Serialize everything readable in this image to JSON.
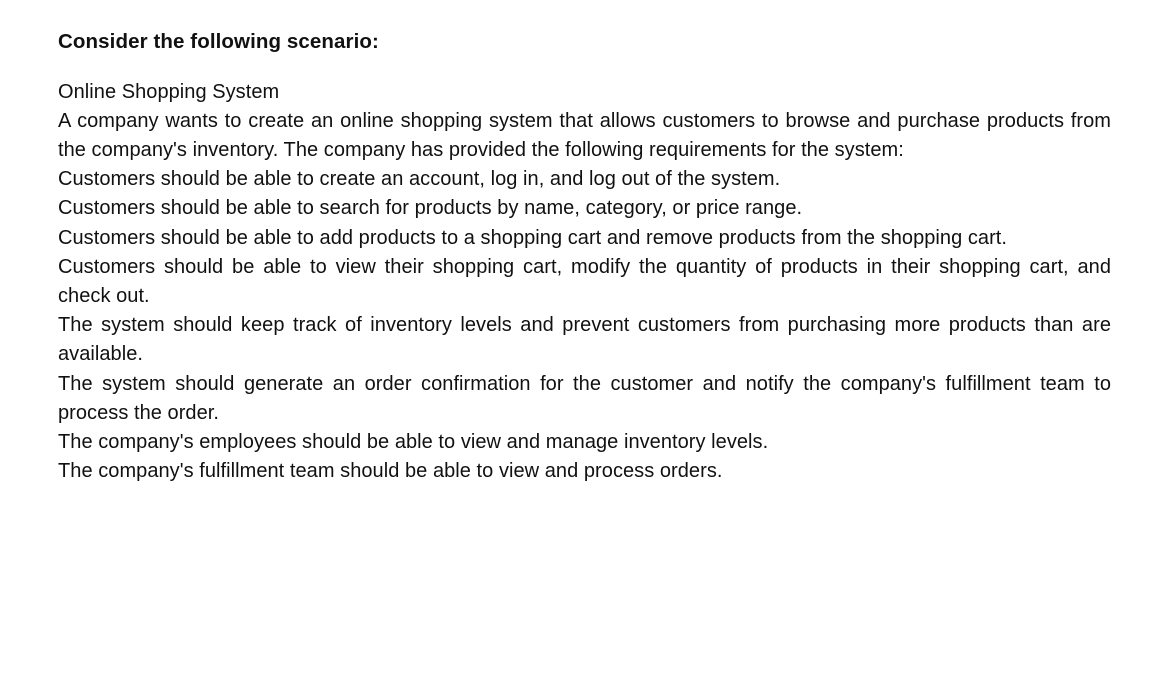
{
  "heading": "Consider the following scenario:",
  "paragraphs": [
    {
      "text": "Online Shopping System",
      "justify": false
    },
    {
      "text": "A company wants to create an online shopping system that allows customers to browse and purchase products from the company's inventory. The company has provided the following requirements for the system:",
      "justify": true
    },
    {
      "text": "Customers should be able to create an account, log in, and log out of the system.",
      "justify": false
    },
    {
      "text": "Customers should be able to search for products by name, category, or price range.",
      "justify": false
    },
    {
      "text": "Customers should be able to add products to a shopping cart and remove products from the shopping cart.",
      "justify": true
    },
    {
      "text": "Customers should be able to view their shopping cart, modify the quantity of products in their shopping cart, and check out.",
      "justify": true
    },
    {
      "text": "The system should keep track of inventory levels and prevent customers from purchasing more products than are available.",
      "justify": true
    },
    {
      "text": "The system should generate an order confirmation for the customer and notify the company's fulfillment team to process the order.",
      "justify": true
    },
    {
      "text": "The company's employees should be able to view and manage inventory levels.",
      "justify": false
    },
    {
      "text": "The company's fulfillment team should be able to view and process orders.",
      "justify": false
    }
  ]
}
